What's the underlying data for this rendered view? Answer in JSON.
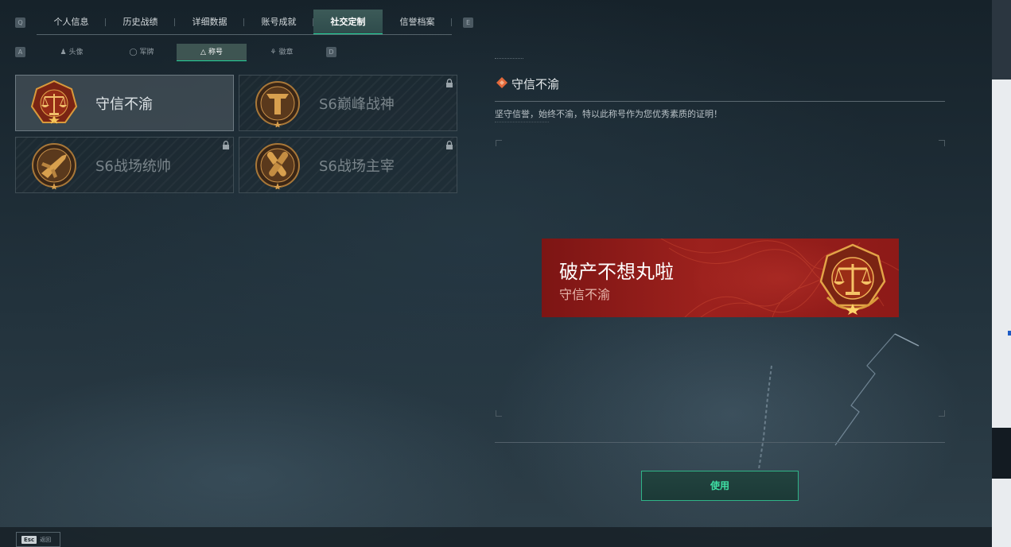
{
  "top_nav": {
    "left_key": "Q",
    "right_key": "E",
    "tabs": [
      {
        "label": "个人信息",
        "active": false
      },
      {
        "label": "历史战绩",
        "active": false
      },
      {
        "label": "详细数据",
        "active": false
      },
      {
        "label": "账号成就",
        "active": false
      },
      {
        "label": "社交定制",
        "active": true
      },
      {
        "label": "信誉档案",
        "active": false
      }
    ]
  },
  "sub_nav": {
    "left_key": "A",
    "right_key": "D",
    "tabs": [
      {
        "label": "头像",
        "icon": "person-icon",
        "active": false
      },
      {
        "label": "军牌",
        "icon": "dogtag-icon",
        "active": false
      },
      {
        "label": "称号",
        "icon": "title-icon",
        "active": true
      },
      {
        "label": "徽章",
        "icon": "medal-icon",
        "active": false
      }
    ]
  },
  "titles": [
    {
      "label": "守信不渝",
      "badge": "scales-badge-icon",
      "locked": false,
      "selected": true
    },
    {
      "label": "S6巅峰战神",
      "badge": "t-emblem-badge-icon",
      "locked": true,
      "selected": false
    },
    {
      "label": "S6战场统帅",
      "badge": "jet-badge-icon",
      "locked": true,
      "selected": false
    },
    {
      "label": "S6战场主宰",
      "badge": "crossed-shells-badge-icon",
      "locked": true,
      "selected": false
    }
  ],
  "detail": {
    "title": "守信不渝",
    "description": "坚守信誉，始终不渝，特以此称号作为您优秀素质的证明！"
  },
  "preview_banner": {
    "player_name": "破产不想丸啦",
    "title": "守信不渝",
    "badge": "scales-badge-icon"
  },
  "actions": {
    "use_label": "使用",
    "esc_key": "Esc",
    "back_label": "返回"
  },
  "colors": {
    "accent": "#23d29a",
    "banner": "#9c211d",
    "badge_gold": "#d99a3b"
  }
}
